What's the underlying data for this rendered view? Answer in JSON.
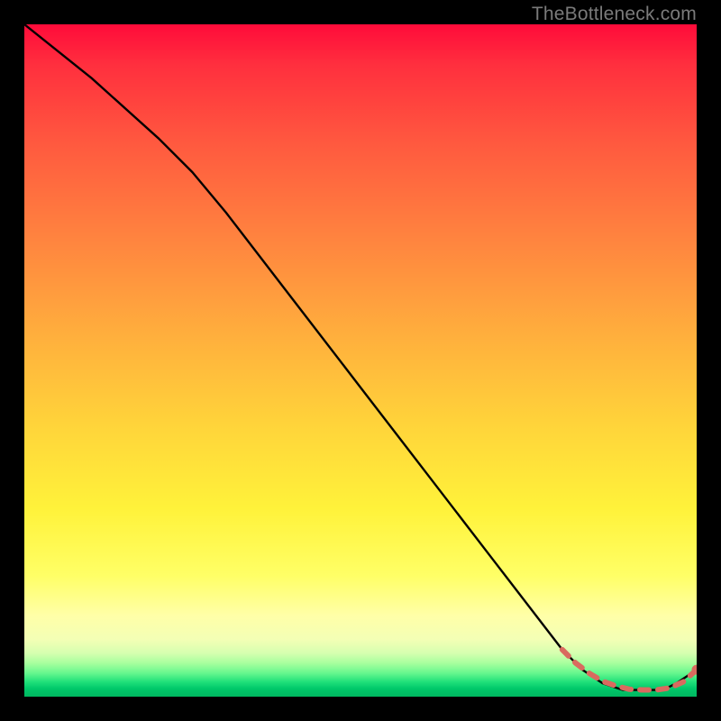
{
  "watermark": "TheBottleneck.com",
  "chart_data": {
    "type": "line",
    "title": "",
    "xlabel": "",
    "ylabel": "",
    "xlim": [
      0,
      100
    ],
    "ylim": [
      0,
      100
    ],
    "grid": false,
    "series": [
      {
        "name": "curve",
        "style": "line",
        "color": "#000000",
        "x": [
          0,
          10,
          20,
          25,
          30,
          40,
          50,
          60,
          70,
          80,
          83,
          86,
          89,
          92,
          95,
          97,
          100
        ],
        "y": [
          100,
          92,
          83,
          78,
          72,
          59,
          46,
          33,
          20,
          7,
          4,
          2,
          1,
          1,
          1,
          2,
          4
        ]
      },
      {
        "name": "dashed-tail",
        "style": "dashed",
        "color": "#d96a5f",
        "x": [
          80,
          82,
          84,
          86,
          88,
          90,
          92,
          94,
          96,
          98,
          100
        ],
        "y": [
          7,
          5,
          3.5,
          2.3,
          1.6,
          1.1,
          1.0,
          1.0,
          1.3,
          2.2,
          4.0
        ]
      },
      {
        "name": "endpoint",
        "style": "point",
        "color": "#d96a5f",
        "x": [
          100
        ],
        "y": [
          4.0
        ]
      }
    ],
    "gradient_stops": [
      {
        "pos": 0.0,
        "color": "#ff0b3a"
      },
      {
        "pos": 0.18,
        "color": "#ff5a3f"
      },
      {
        "pos": 0.46,
        "color": "#ffae3d"
      },
      {
        "pos": 0.72,
        "color": "#fff23a"
      },
      {
        "pos": 0.88,
        "color": "#ffffa8"
      },
      {
        "pos": 0.965,
        "color": "#66f78e"
      },
      {
        "pos": 1.0,
        "color": "#00b860"
      }
    ]
  }
}
